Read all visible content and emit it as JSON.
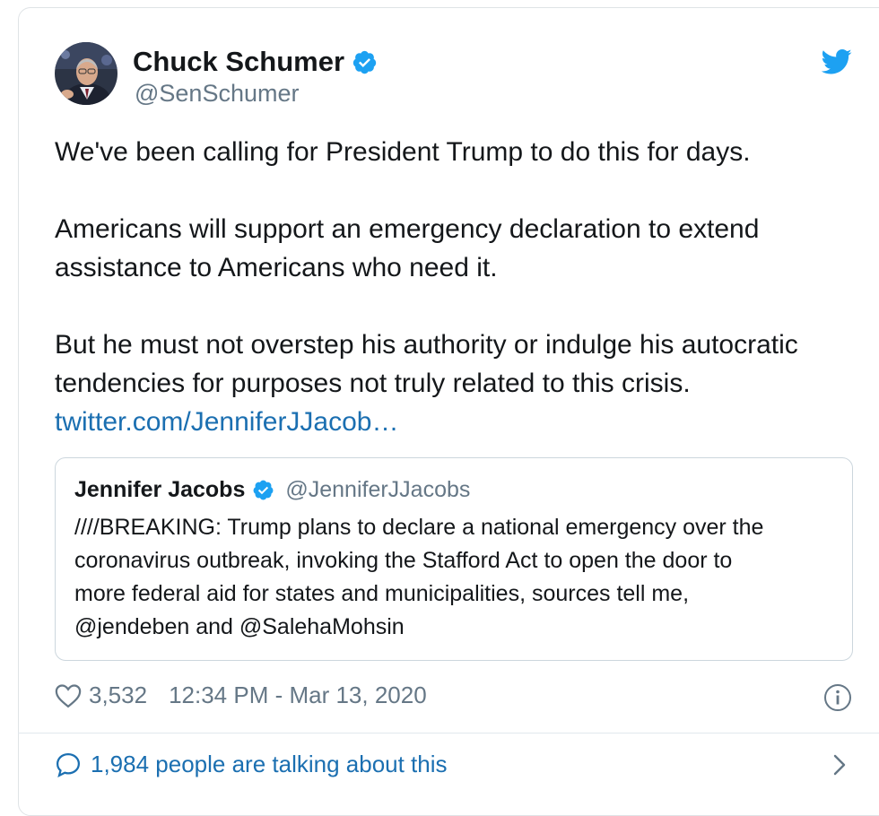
{
  "author": {
    "name": "Chuck Schumer",
    "handle": "@SenSchumer"
  },
  "tweet": {
    "line1": "We've been calling for President Trump to do this for days.",
    "para2_line1": "Americans will support an emergency declaration to extend",
    "para2_line2": "assistance to Americans who need it.",
    "para3_line1": "But he must not overstep his authority or indulge his autocratic",
    "para3_line2": "tendencies for purposes not truly related to this crisis.",
    "link": "twitter.com/JenniferJJacob…"
  },
  "quote": {
    "name": "Jennifer Jacobs",
    "handle": "@JenniferJJacobs",
    "line1": "////BREAKING: Trump plans to declare a national emergency over the",
    "line2": "coronavirus outbreak, invoking the Stafford Act to open the door to",
    "line3": "more federal aid for states and municipalities, sources tell me,",
    "line4": "@jendeben and @SalehaMohsin"
  },
  "meta": {
    "likes": "3,532",
    "timestamp": "12:34 PM - Mar 13, 2020"
  },
  "footer": {
    "talking": "1,984 people are talking about this"
  },
  "colors": {
    "twitter_blue": "#1da1f2",
    "link_blue": "#1b6fb1",
    "secondary_text": "#657786"
  },
  "icons": {
    "verified": "verified-badge-icon",
    "brand": "twitter-bird-icon",
    "like": "heart-icon",
    "info": "info-icon",
    "conversation": "speech-bubble-icon",
    "more": "chevron-right-icon"
  }
}
